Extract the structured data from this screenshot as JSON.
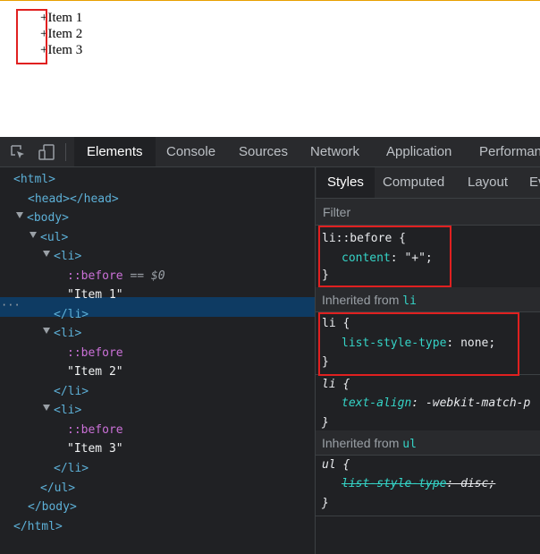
{
  "preview": {
    "items": [
      "+Item 1",
      "+Item 2",
      "+Item 3"
    ]
  },
  "devtools": {
    "tabs": [
      "Elements",
      "Console",
      "Sources",
      "Network",
      "Application",
      "Performan"
    ],
    "active_tab": "Elements",
    "elements_tree": {
      "html_open": "<html>",
      "head": "<head></head>",
      "body_open": "<body>",
      "ul_open": "<ul>",
      "li_open": "<li>",
      "before": "::before",
      "selected_marker": "== $0",
      "dots": "···",
      "item1": "\"Item 1\"",
      "item2": "\"Item 2\"",
      "item3": "\"Item 3\"",
      "li_close": "</li>",
      "ul_close": "</ul>",
      "body_close": "</body>",
      "html_close": "</html>"
    },
    "styles_pane": {
      "subtabs": [
        "Styles",
        "Computed",
        "Layout",
        "Ev"
      ],
      "active_subtab": "Styles",
      "filter_placeholder": "Filter",
      "rule1": {
        "selector": "li::before {",
        "property": "content",
        "value": "\"+\";",
        "close": "}"
      },
      "inherited_li": {
        "label": "Inherited from ",
        "tag": "li"
      },
      "rule2": {
        "selector": "li {",
        "property": "list-style-type",
        "value": "none;",
        "close": "}"
      },
      "rule3": {
        "selector": "li {",
        "property": "text-align",
        "value": "-webkit-match-p",
        "close": "}"
      },
      "inherited_ul": {
        "label": "Inherited from ",
        "tag": "ul"
      },
      "rule4": {
        "selector": "ul {",
        "property": "list-style-type",
        "value": "disc;",
        "close": "}"
      }
    },
    "colors": {
      "highlight_box": "#e02020",
      "selected_row": "#0e3b63",
      "tag": "#5db0d7",
      "pseudo": "#cb71d8",
      "property": "#35d4c7"
    }
  }
}
